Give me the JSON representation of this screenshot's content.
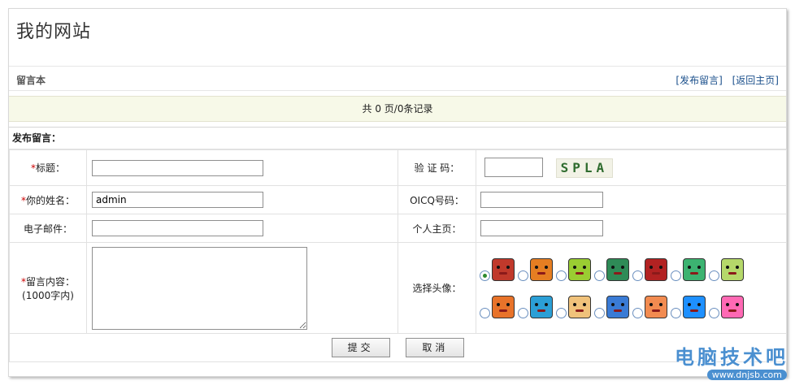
{
  "site": {
    "title": "我的网站"
  },
  "section": {
    "title": "留言本",
    "links": [
      "[发布留言]",
      "[返回主页]"
    ]
  },
  "records": {
    "text": "共 0 页/0条记录"
  },
  "form": {
    "header": "发布留言：",
    "title_label": "标题：",
    "title_value": "",
    "captcha_label": "验 证 码：",
    "captcha_value": "",
    "captcha_text": "SPLA",
    "name_label": "你的姓名：",
    "name_value": "admin",
    "oicq_label": "OICQ号码：",
    "oicq_value": "",
    "email_label": "电子邮件：",
    "email_value": "",
    "homepage_label": "个人主页：",
    "homepage_value": "",
    "content_label": "留言内容：",
    "content_hint": "(1000字内)",
    "avatar_label": "选择头像：",
    "required_mark": "*",
    "submit_label": "提交",
    "cancel_label": "取消",
    "avatars": [
      {
        "color": "#c0392b",
        "selected": true
      },
      {
        "color": "#e67e22",
        "selected": false
      },
      {
        "color": "#9acd32",
        "selected": false
      },
      {
        "color": "#2e8b57",
        "selected": false
      },
      {
        "color": "#b22222",
        "selected": false
      },
      {
        "color": "#3cb371",
        "selected": false
      },
      {
        "color": "#b5d86a",
        "selected": false
      },
      {
        "color": "#e8732a",
        "selected": false
      },
      {
        "color": "#2b9fd6",
        "selected": false
      },
      {
        "color": "#f0c27b",
        "selected": false
      },
      {
        "color": "#3a7bd5",
        "selected": false
      },
      {
        "color": "#f28b50",
        "selected": false
      },
      {
        "color": "#1e90ff",
        "selected": false
      },
      {
        "color": "#ff69b4",
        "selected": false
      }
    ]
  },
  "watermark": {
    "cn": "电脑技术吧",
    "url": "www.dnjsb.com"
  }
}
